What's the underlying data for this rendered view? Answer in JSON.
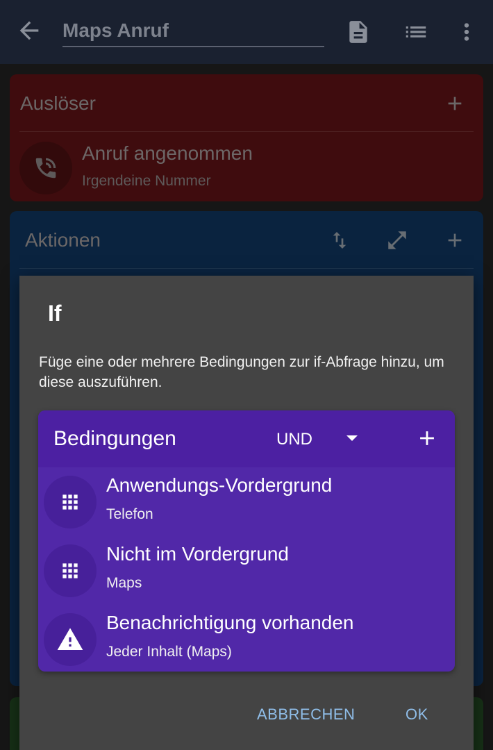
{
  "header": {
    "title": "Maps Anruf",
    "icons": [
      "arrow-left-icon",
      "document-icon",
      "list-icon",
      "more-vert-icon"
    ]
  },
  "trigger_card": {
    "title": "Auslöser",
    "item": {
      "title": "Anruf angenommen",
      "subtitle": "Irgendeine Nummer",
      "icon": "phone-in-talk-icon"
    }
  },
  "actions_card": {
    "title": "Aktionen",
    "icons": [
      "swap-vert-icon",
      "expand-icon",
      "plus-icon"
    ]
  },
  "dialog": {
    "title": "If",
    "description": "Füge eine oder mehrere Bedingungen zur if-Abfrage hinzu, um diese auszuführen.",
    "conditions": {
      "title": "Bedingungen",
      "operator": "UND",
      "items": [
        {
          "name": "Anwendungs-Vordergrund",
          "detail": "Telefon",
          "icon": "apps-grid-icon"
        },
        {
          "name": "Nicht im Vordergrund",
          "detail": "Maps",
          "icon": "apps-grid-icon"
        },
        {
          "name": "Benachrichtigung vorhanden",
          "detail": "Jeder Inhalt (Maps)",
          "icon": "warning-icon"
        }
      ]
    },
    "cancel_label": "ABBRECHEN",
    "ok_label": "OK"
  },
  "colors": {
    "trigger_card": "#4a0f11",
    "actions_card": "#0c2a4a",
    "conditions_card": "#5128a8",
    "dialog": "#444444",
    "accent_button": "#8fbde8"
  }
}
